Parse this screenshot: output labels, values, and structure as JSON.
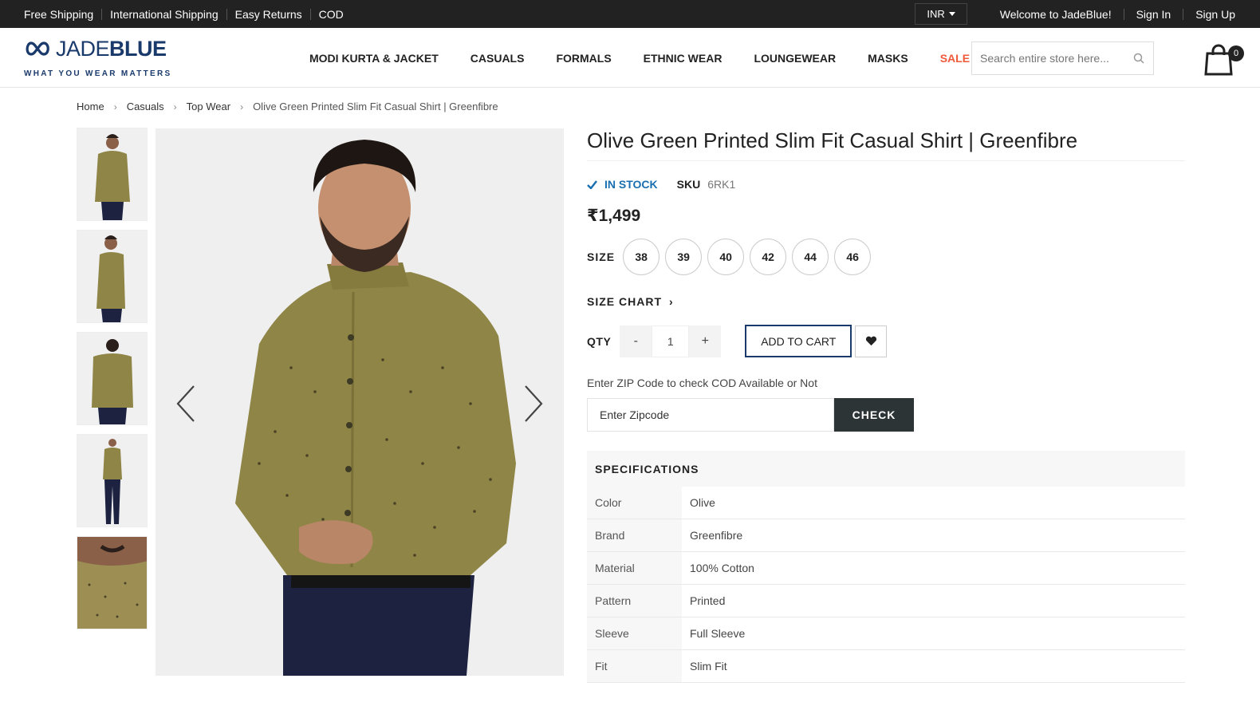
{
  "topbar": {
    "links": [
      "Free Shipping",
      "International Shipping",
      "Easy Returns",
      "COD"
    ],
    "currency": "INR",
    "welcome": "Welcome to JadeBlue!",
    "sign_in": "Sign In",
    "sign_up": "Sign Up"
  },
  "header": {
    "logo_light": "JADE",
    "logo_bold": "BLUE",
    "tagline": "WHAT YOU WEAR MATTERS",
    "nav": [
      "MODI KURTA & JACKET",
      "CASUALS",
      "FORMALS",
      "ETHNIC WEAR",
      "LOUNGEWEAR",
      "MASKS",
      "SALE"
    ],
    "search_placeholder": "Search entire store here...",
    "cart_count": "0"
  },
  "breadcrumb": [
    "Home",
    "Casuals",
    "Top Wear",
    "Olive Green Printed Slim Fit Casual Shirt | Greenfibre"
  ],
  "product": {
    "title": "Olive Green Printed Slim Fit Casual Shirt | Greenfibre",
    "stock": "IN STOCK",
    "sku_label": "SKU",
    "sku": "6RK1",
    "price": "₹1,499",
    "size_label": "SIZE",
    "sizes": [
      "38",
      "39",
      "40",
      "42",
      "44",
      "46"
    ],
    "size_chart": "SIZE CHART",
    "qty_label": "QTY",
    "qty_minus": "-",
    "qty_value": "1",
    "qty_plus": "+",
    "add_to_cart": "ADD TO CART",
    "zip_label": "Enter ZIP Code to check COD Available or Not",
    "zip_placeholder": "Enter Zipcode",
    "check": "CHECK",
    "shirt_color": "#8f8547",
    "accent": "#1a3a6b"
  },
  "specs": {
    "heading": "SPECIFICATIONS",
    "rows": [
      {
        "key": "Color",
        "value": "Olive"
      },
      {
        "key": "Brand",
        "value": "Greenfibre"
      },
      {
        "key": "Material",
        "value": "100% Cotton"
      },
      {
        "key": "Pattern",
        "value": "Printed"
      },
      {
        "key": "Sleeve",
        "value": "Full Sleeve"
      },
      {
        "key": "Fit",
        "value": "Slim Fit"
      }
    ]
  }
}
